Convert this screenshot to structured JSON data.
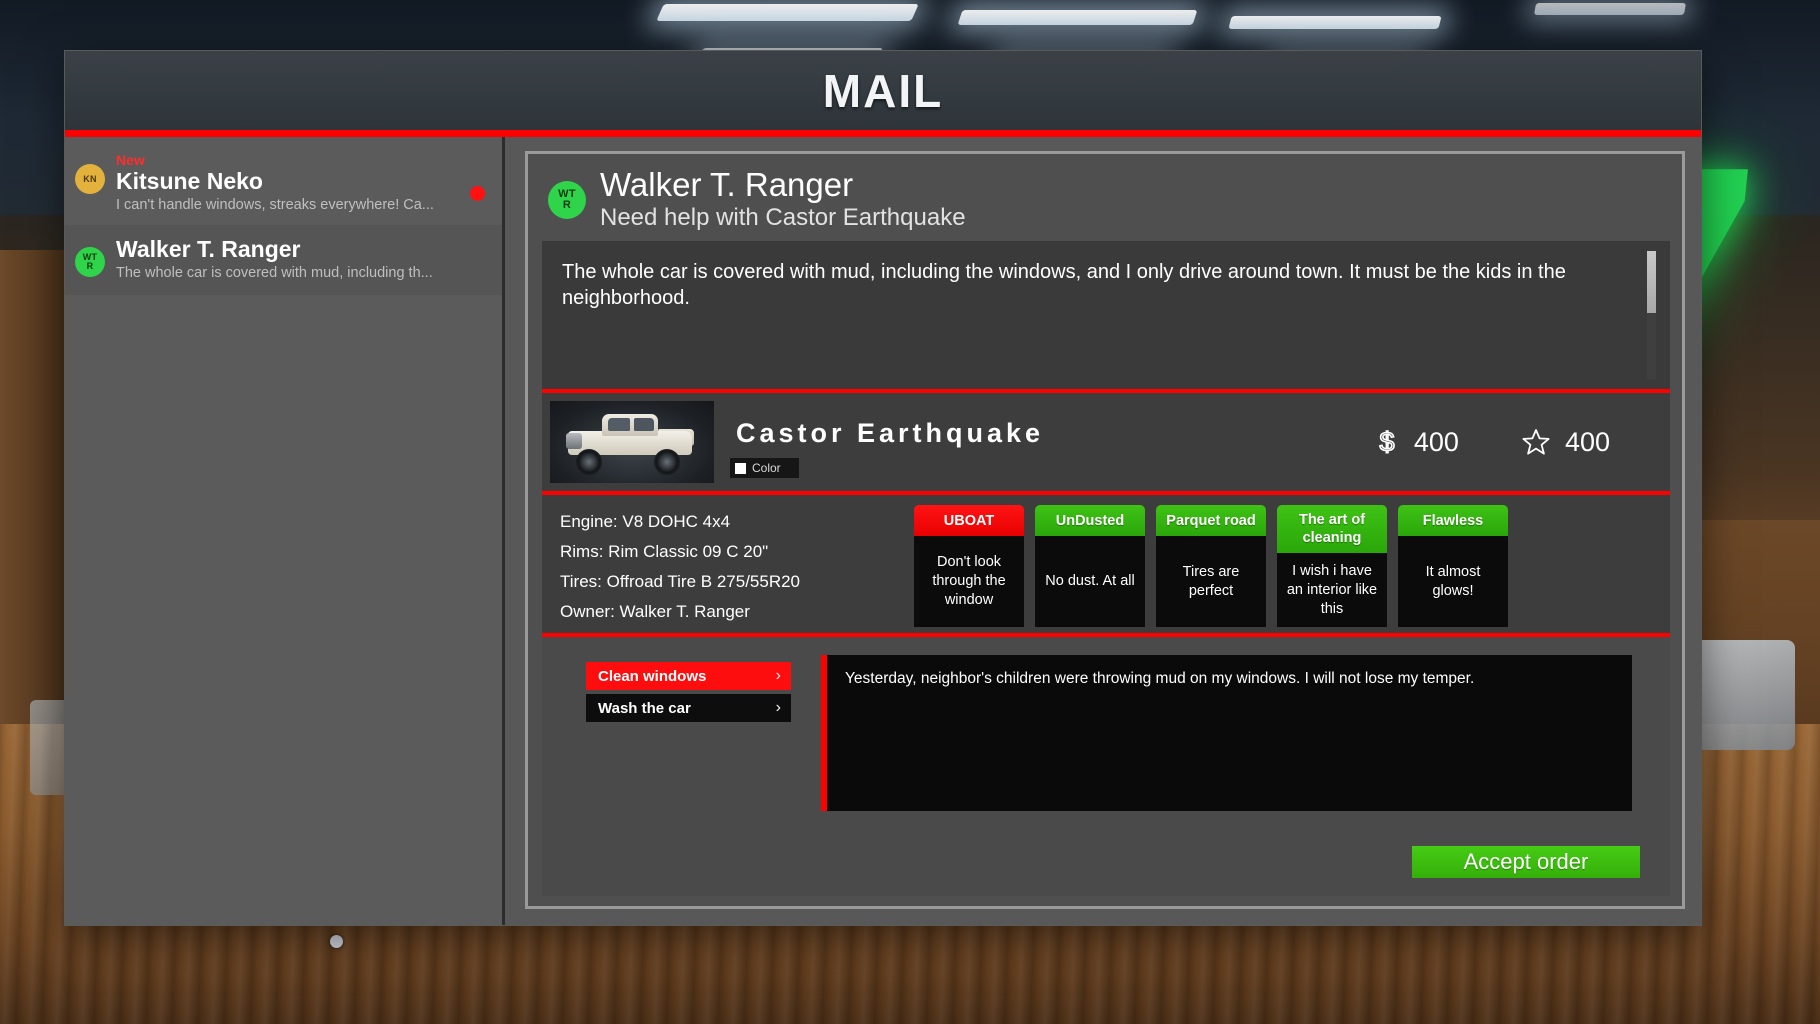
{
  "window": {
    "title": "MAIL"
  },
  "sidebar": {
    "items": [
      {
        "badge": "New",
        "initials_top": "KN",
        "initials_bottom": "",
        "avatar_color": "#e3b23c",
        "name": "Kitsune Neko",
        "preview": "I can't handle windows, streaks everywhere! Ca...",
        "unread": true,
        "selected": false
      },
      {
        "badge": "",
        "initials_top": "WT",
        "initials_bottom": "R",
        "avatar_color": "#2fd44a",
        "name": "Walker T. Ranger",
        "preview": "The whole car is covered with mud, including th...",
        "unread": false,
        "selected": true
      }
    ]
  },
  "mail": {
    "sender_name": "Walker T. Ranger",
    "sender_initials_top": "WT",
    "sender_initials_bottom": "R",
    "sender_avatar_color": "#2fd44a",
    "subject": "Need help with Castor Earthquake",
    "body": "The whole car is covered with mud, including the windows, and I only drive around town. It must be the kids in the neighborhood."
  },
  "car": {
    "name": "Castor Earthquake",
    "color_label": "Color",
    "color_swatch": "#ffffff",
    "money_icon": "dollar-icon",
    "money_value": "400",
    "star_icon": "star-icon",
    "star_value": "400",
    "specs": [
      "Engine: V8 DOHC 4x4",
      "Rims: Rim Classic 09 C 20\"",
      "Tires: Offroad Tire B 275/55R20",
      "Owner: Walker T. Ranger"
    ]
  },
  "reviews": [
    {
      "title": "UBOAT",
      "text": "Don't look through the window",
      "tone": "bad"
    },
    {
      "title": "UnDusted",
      "text": "No dust. At all",
      "tone": "good"
    },
    {
      "title": "Parquet road",
      "text": "Tires are perfect",
      "tone": "good"
    },
    {
      "title": "The art of cleaning",
      "text": "I wish i have an interior like this",
      "tone": "good"
    },
    {
      "title": "Flawless",
      "text": "It almost glows!",
      "tone": "good"
    }
  ],
  "tasks": [
    {
      "label": "Clean windows",
      "chevron": "›",
      "state": "active"
    },
    {
      "label": "Wash the car",
      "chevron": "›",
      "state": "idle"
    }
  ],
  "note": {
    "text": "Yesterday, neighbor's children were throwing mud on my windows. I will not lose my temper."
  },
  "actions": {
    "accept_label": "Accept order"
  },
  "colors": {
    "accent_red": "#ff0000",
    "accent_green": "#3fc215",
    "panel_bg": "#4f4f4f"
  }
}
